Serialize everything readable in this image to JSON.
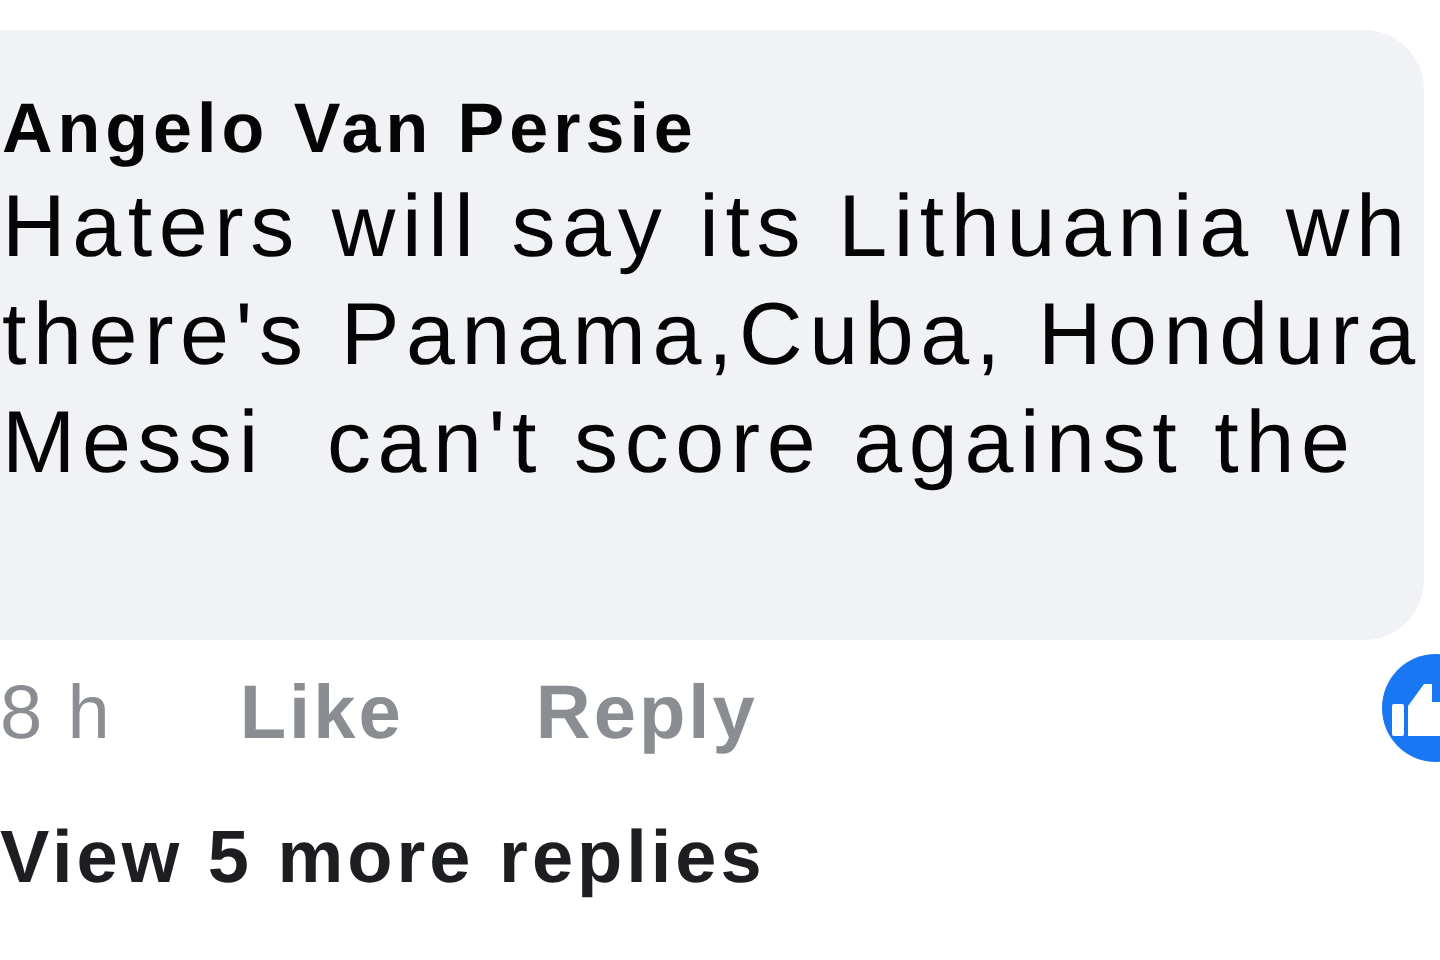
{
  "comment": {
    "author": "Angelo Van Persie",
    "text_lines": [
      "Haters will say its Lithuania wh",
      "there's Panama,Cuba, Hondura",
      "Messi  can't score against the"
    ],
    "time": "8 h",
    "actions": [
      "Like",
      "Reply"
    ]
  },
  "view_more": "View 5 more replies"
}
